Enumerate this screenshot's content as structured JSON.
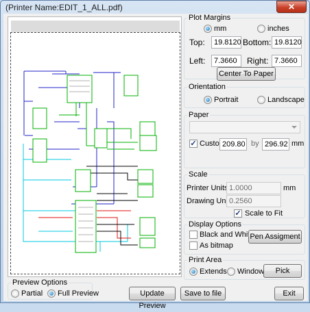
{
  "window": {
    "title": "(Printer Name:EDIT_1_ALL.pdf)",
    "close_glyph": "✕"
  },
  "plot_margins": {
    "legend": "Plot Margins",
    "units": [
      {
        "label": "mm",
        "selected": true
      },
      {
        "label": "inches",
        "selected": false
      }
    ],
    "top_label": "Top:",
    "top_value": "19.8120",
    "bottom_label": "Bottom:",
    "bottom_value": "19.8120",
    "left_label": "Left:",
    "left_value": "7.3660",
    "right_label": "Right:",
    "right_value": "7.3660",
    "center_button": "Center To Paper"
  },
  "orientation": {
    "legend": "Orientation",
    "options": [
      {
        "label": "Portrait",
        "selected": true
      },
      {
        "label": "Landscape",
        "selected": false
      }
    ]
  },
  "paper": {
    "legend": "Paper",
    "selected": "",
    "custom_checked": true,
    "custom_label": "Custom",
    "width": "209.80",
    "by_label": "by",
    "height": "296.92",
    "unit": "mm"
  },
  "scale": {
    "legend": "Scale",
    "printer_units_label": "Printer Units:",
    "printer_units_value": "1.0000",
    "unit": "mm",
    "drawing_units_label": "Drawing Units:",
    "drawing_units_value": "0.2560",
    "scale_to_fit_checked": true,
    "scale_to_fit_label": "Scale to Fit"
  },
  "display_options": {
    "legend": "Display Options",
    "black_and_white": {
      "label": "Black and White",
      "checked": false
    },
    "as_bitmap": {
      "label": "As bitmap",
      "checked": false
    },
    "pen_button": "Pen Assigment"
  },
  "print_area": {
    "legend": "Print Area",
    "options": [
      {
        "label": "Extends",
        "selected": true
      },
      {
        "label": "Window",
        "selected": false
      }
    ],
    "pick_button": "Pick"
  },
  "preview_options": {
    "legend": "Preview Options",
    "options": [
      {
        "label": "Partial",
        "selected": false
      },
      {
        "label": "Full Preview",
        "selected": true
      }
    ]
  },
  "buttons": {
    "update_preview": "Update Preview",
    "save_to_file": "Save to file",
    "exit": "Exit"
  },
  "colors": {
    "wire_blue": "#2020c8",
    "wire_red": "#e01010",
    "wire_cyan": "#00c8e0",
    "wire_black": "#000000",
    "block_green": "#00b000"
  }
}
